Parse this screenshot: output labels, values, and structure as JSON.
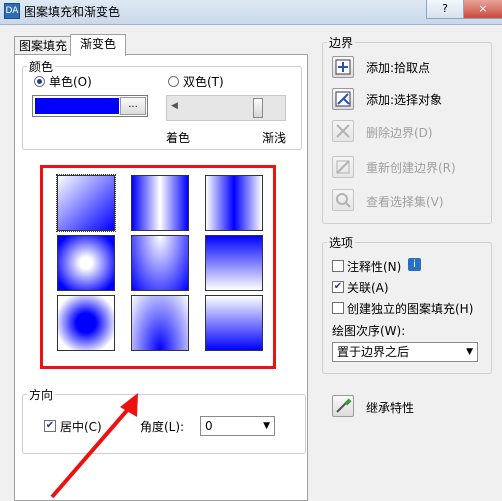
{
  "window": {
    "title": "图案填充和渐变色",
    "icon_label": "DA",
    "help_button": "?",
    "close_button": "×"
  },
  "tabs": [
    {
      "label": "图案填充"
    },
    {
      "label": "渐变色"
    }
  ],
  "color_group": {
    "legend": "颜色",
    "single_label": "单色(O)",
    "double_label": "双色(T)",
    "selected": "single",
    "swatch_color": "#0000ff",
    "browse_label": "...",
    "shade_label": "着色",
    "tint_label": "渐浅"
  },
  "gradients": [
    {
      "kind": "linear-diagonal",
      "selected": true
    },
    {
      "kind": "cylinder-vertical"
    },
    {
      "kind": "inv-cylinder-vertical"
    },
    {
      "kind": "spherical-light"
    },
    {
      "kind": "hemispherical"
    },
    {
      "kind": "curved"
    },
    {
      "kind": "spherical-dark"
    },
    {
      "kind": "inv-hemispherical"
    },
    {
      "kind": "inv-curved"
    }
  ],
  "orientation_group": {
    "legend": "方向",
    "centered_label": "居中(C)",
    "centered_checked": true,
    "angle_label": "角度(L):",
    "angle_value": "0"
  },
  "boundaries": {
    "legend": "边界",
    "add_pick_points": "添加:拾取点",
    "add_select_objects": "添加:选择对象",
    "remove_boundaries": "删除边界(D)",
    "recreate_boundary": "重新创建边界(R)",
    "view_selections": "查看选择集(V)"
  },
  "options": {
    "legend": "选项",
    "annotative_label": "注释性(N)",
    "annotative_checked": false,
    "info_icon": "i",
    "associative_label": "关联(A)",
    "associative_checked": true,
    "independent_label": "创建独立的图案填充(H)",
    "independent_checked": false,
    "draw_order_label": "绘图次序(W):",
    "draw_order_value": "置于边界之后"
  },
  "inherit_label": "继承特性",
  "accent_colors": {
    "highlight": "#ee1111",
    "gradient_blue": "#0000ff"
  }
}
